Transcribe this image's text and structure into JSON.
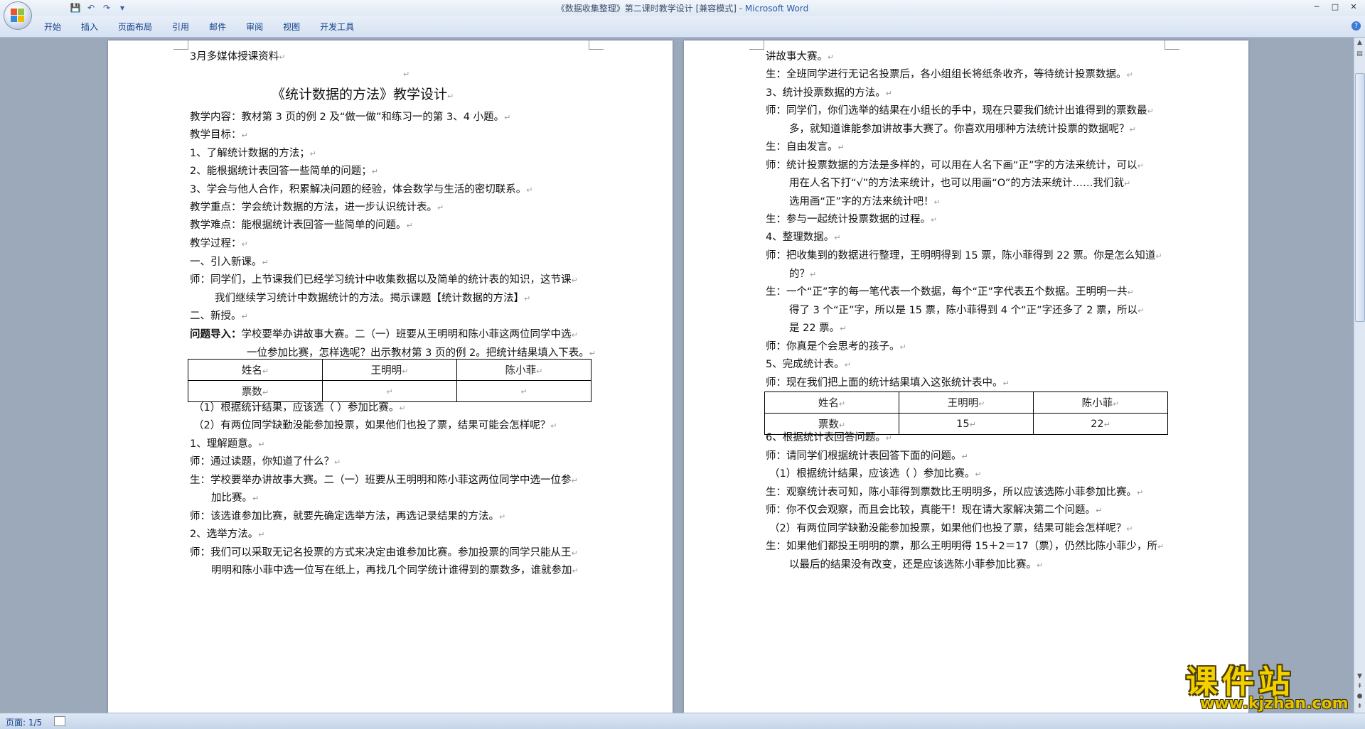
{
  "window": {
    "title": "《数据收集整理》第二课时教学设计 [兼容模式] - ",
    "app_name": "Microsoft Word"
  },
  "qat": {
    "save_icon": "💾",
    "undo_icon": "↶",
    "redo_icon": "↷",
    "more_icon": "▾"
  },
  "window_controls": {
    "minimize": "─",
    "maximize": "□",
    "close": "✕"
  },
  "ribbon": {
    "tabs": [
      "开始",
      "插入",
      "页面布局",
      "引用",
      "邮件",
      "审阅",
      "视图",
      "开发工具"
    ],
    "help": "?"
  },
  "page1": {
    "lines": [
      "3月多媒体授课资料",
      "",
      "《统计数据的方法》教学设计",
      "教学内容：教材第 3 页的例 2 及“做一做”和练习一的第 3、4 小题。",
      "教学目标：",
      "1、了解统计数据的方法；",
      "2、能根据统计表回答一些简单的问题；",
      "3、学会与他人合作，积累解决问题的经验，体会数学与生活的密切联系。",
      "教学重点：学会统计数据的方法，进一步认识统计表。",
      "教学难点：能根据统计表回答一些简单的问题。",
      "教学过程：",
      "一、引入新课。",
      "师：同学们，上节课我们已经学习统计中收集数据以及简单的统计表的知识，这节课",
      "我们继续学习统计中数据统计的方法。揭示课题【统计数据的方法】",
      "二、新授。",
      "学校要举办讲故事大赛。二（一）班要从王明明和陈小菲这两位同学中选",
      "一位参加比赛，怎样选呢？出示教材第 3 页的例 2。把统计结果填入下表。",
      "（1）根据统计结果，应该选（        ）参加比赛。",
      "（2）有两位同学缺勤没能参加投票，如果他们也投了票，结果可能会怎样呢？",
      "1、理解题意。",
      "师：通过读题，你知道了什么？",
      "生：学校要举办讲故事大赛。二（一）班要从王明明和陈小菲这两位同学中选一位参",
      "加比赛。",
      "师：该选谁参加比赛，就要先确定选举方法，再选记录结果的方法。",
      "2、选举方法。",
      "师：我们可以采取无记名投票的方式来决定由谁参加比赛。参加投票的同学只能从王",
      "明明和陈小菲中选一位写在纸上，再找几个同学统计谁得到的票数多，谁就参加"
    ],
    "lead_bold": "问题导入：",
    "table": {
      "headers": [
        "姓名",
        "王明明",
        "陈小菲"
      ],
      "row": [
        "票数",
        "",
        ""
      ]
    }
  },
  "page2": {
    "lines": [
      "讲故事大赛。",
      "生：全班同学进行无记名投票后，各小组组长将纸条收齐，等待统计投票数据。",
      "3、统计投票数据的方法。",
      "师：同学们，你们选举的结果在小组长的手中，现在只要我们统计出谁得到的票数最",
      "多，就知道谁能参加讲故事大赛了。你喜欢用哪种方法统计投票的数据呢？",
      "生：自由发言。",
      "师：统计投票数据的方法是多样的，可以用在人名下画“正”字的方法来统计，可以",
      "用在人名下打“√”的方法来统计，也可以用画“O”的方法来统计……我们就",
      "选用画“正”字的方法来统计吧！",
      "生：参与一起统计投票数据的过程。",
      "4、整理数据。",
      "师：把收集到的数据进行整理，王明明得到 15 票，陈小菲得到 22 票。你是怎么知道",
      "的？",
      "生：一个“正”字的每一笔代表一个数据，每个“正”字代表五个数据。王明明一共",
      "得了 3 个“正”字，所以是 15 票，陈小菲得到 4 个“正”字还多了 2 票，所以",
      "是 22 票。",
      "师：你真是个会思考的孩子。",
      "5、完成统计表。",
      "师：现在我们把上面的统计结果填入这张统计表中。",
      "6、根据统计表回答问题。",
      "师：请同学们根据统计表回答下面的问题。",
      "（1）根据统计结果，应该选（        ）参加比赛。",
      "生：观察统计表可知，陈小菲得到票数比王明明多，所以应该选陈小菲参加比赛。",
      "师：你不仅会观察，而且会比较，真能干！现在请大家解决第二个问题。",
      "（2）有两位同学缺勤没能参加投票，如果他们也投了票，结果可能会怎样呢？",
      "生：如果他们都投王明明的票，那么王明明得 15＋2＝17（票），仍然比陈小菲少，所",
      "以最后的结果没有改变，还是应该选陈小菲参加比赛。"
    ],
    "table": {
      "headers": [
        "姓名",
        "王明明",
        "陈小菲"
      ],
      "row": [
        "票数",
        "15",
        "22"
      ]
    }
  },
  "para_mark": "↵",
  "status": {
    "page": "页面: 1/5"
  },
  "watermark": {
    "big": "课件站",
    "small": "www.kjzhan.com"
  }
}
